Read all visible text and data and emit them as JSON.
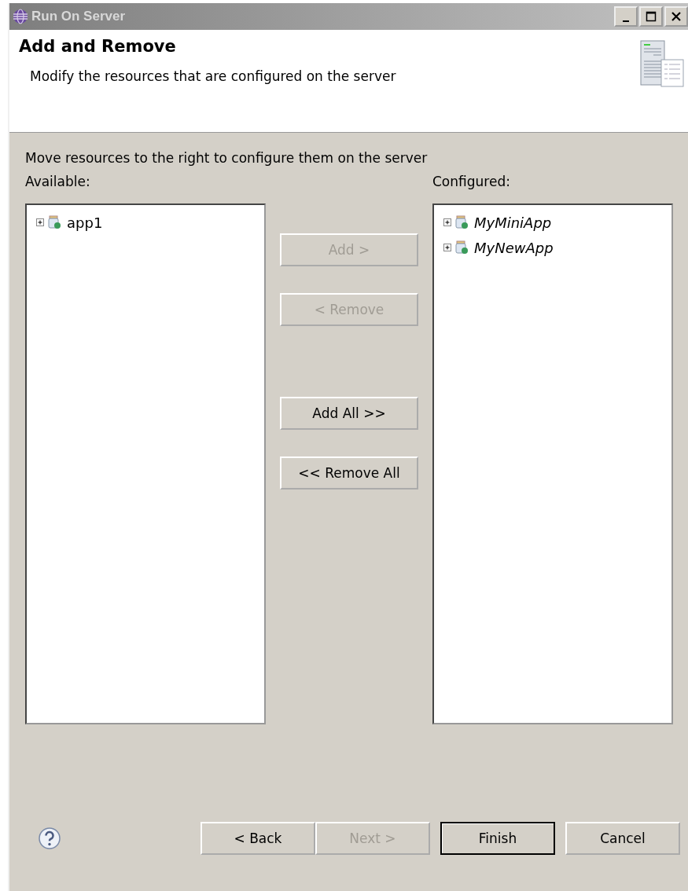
{
  "window": {
    "title": "Run On Server"
  },
  "header": {
    "title": "Add and Remove",
    "description": "Modify the resources that are configured on the server"
  },
  "instruction": "Move resources to the right to configure them on the server",
  "available": {
    "label": "Available:",
    "items": [
      {
        "label": "app1",
        "expanded": false
      }
    ]
  },
  "configured": {
    "label": "Configured:",
    "items": [
      {
        "label": "MyMiniApp",
        "expanded": false
      },
      {
        "label": "MyNewApp",
        "expanded": false
      }
    ]
  },
  "move_buttons": [
    {
      "label": "Add >",
      "disabled": true
    },
    {
      "label": "< Remove",
      "disabled": true
    },
    {
      "label": "Add All >>",
      "disabled": false
    },
    {
      "label": "<< Remove All",
      "disabled": false
    }
  ],
  "footer_buttons": [
    {
      "label": "< Back",
      "disabled": false,
      "default": false
    },
    {
      "label": "Next >",
      "disabled": true,
      "default": false
    },
    {
      "label": "Finish",
      "disabled": false,
      "default": true
    },
    {
      "label": "Cancel",
      "disabled": false,
      "default": false
    }
  ]
}
